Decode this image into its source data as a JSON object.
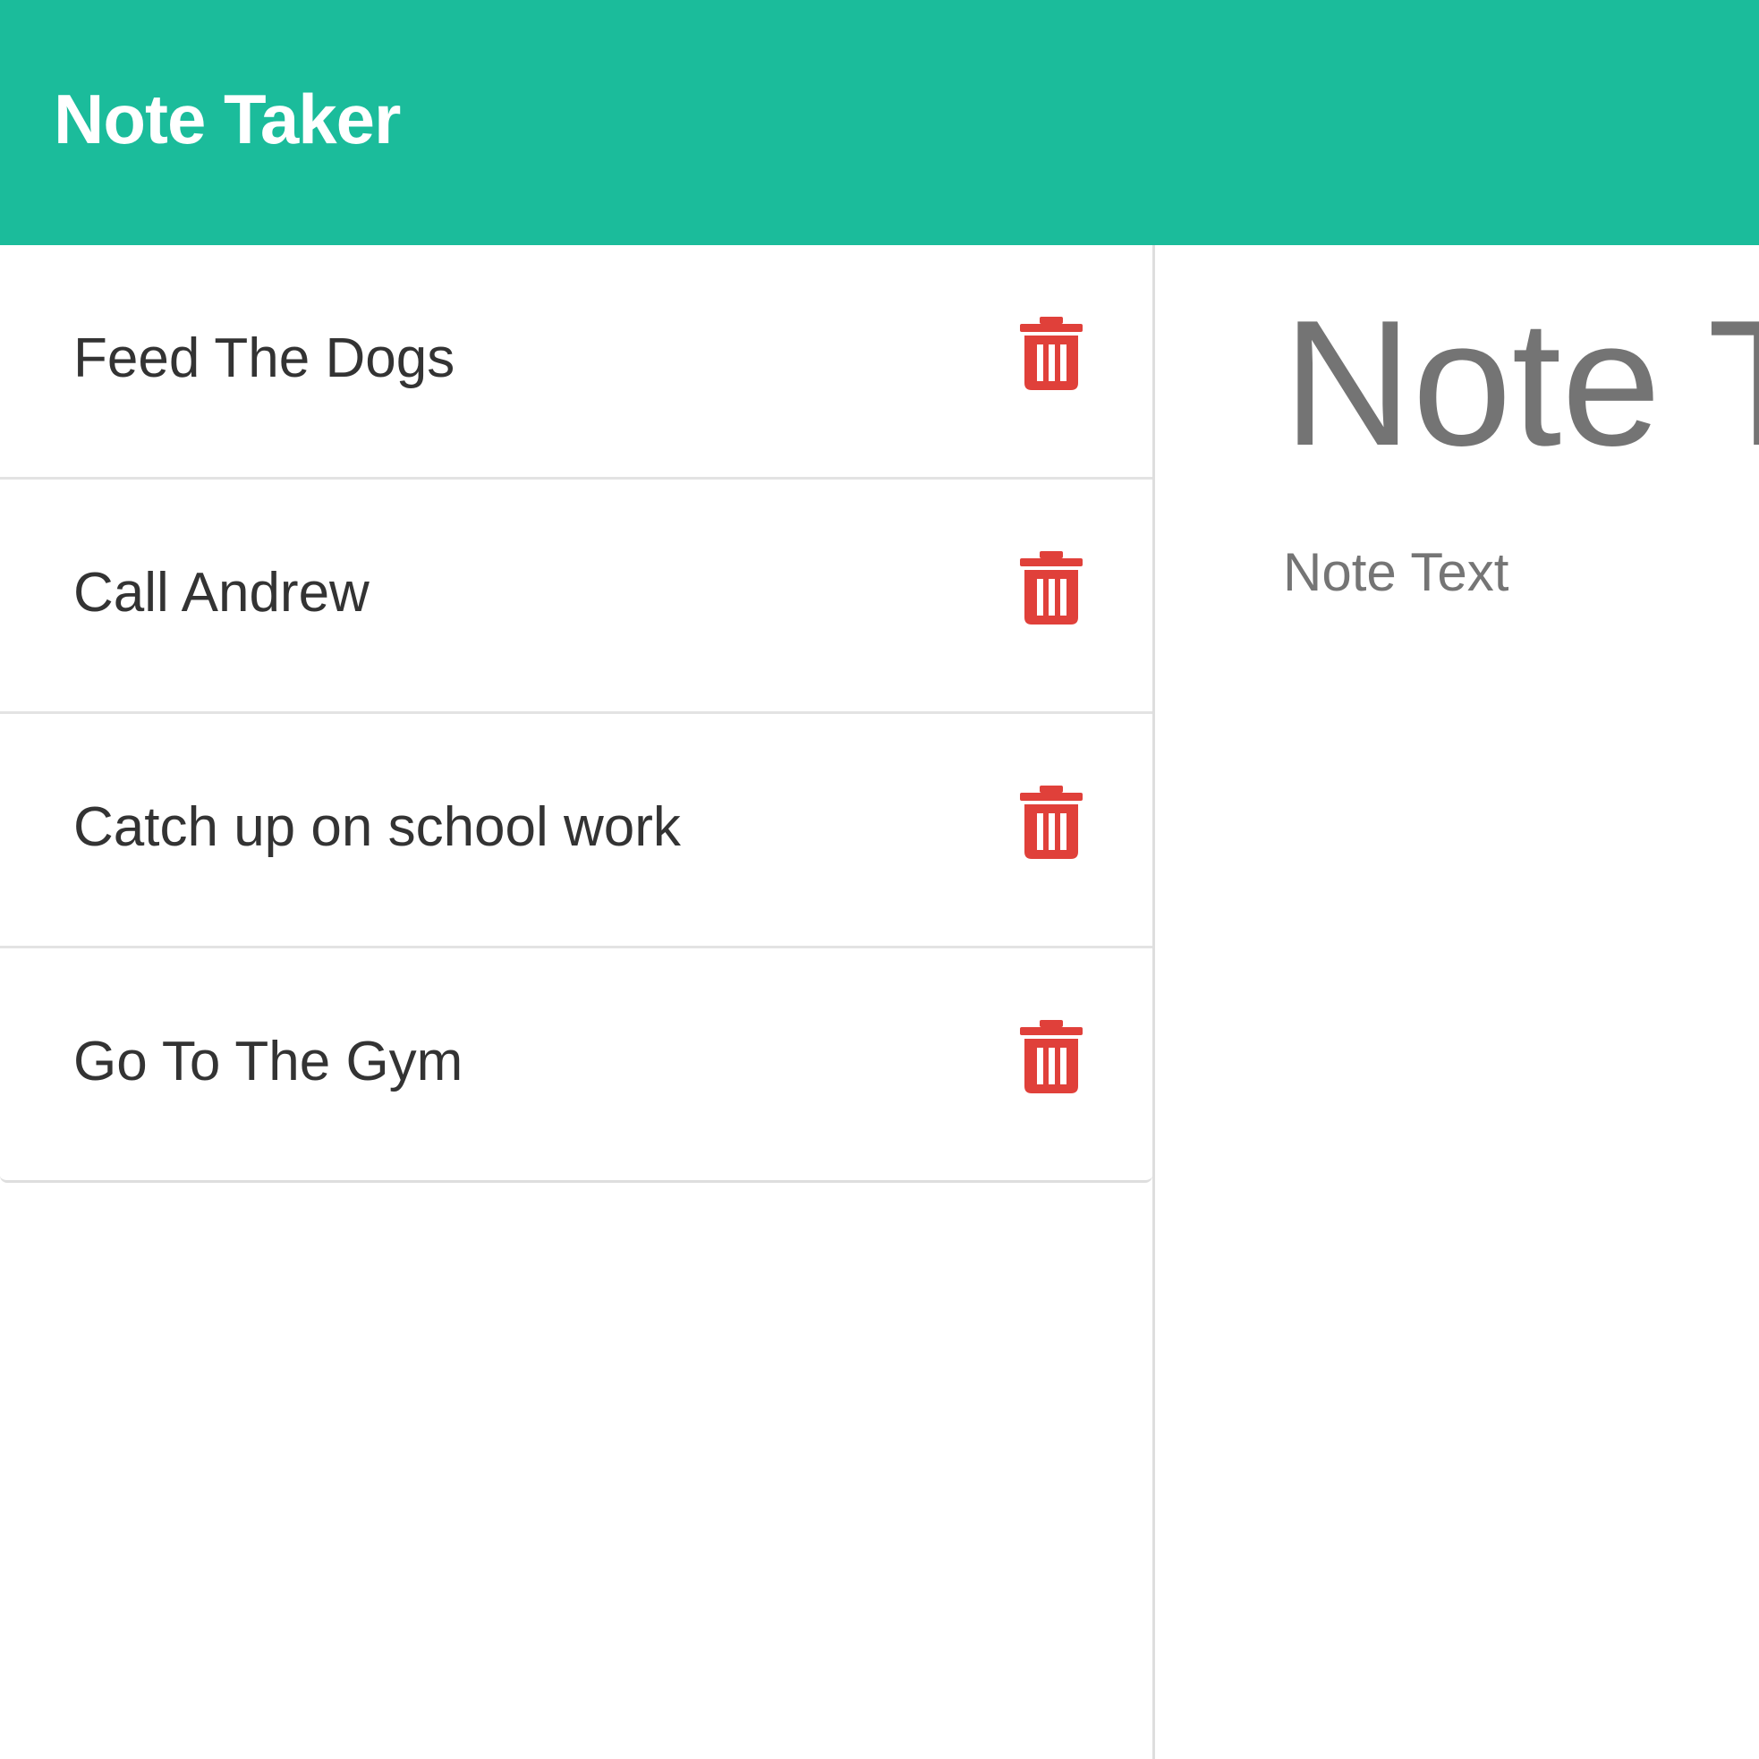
{
  "navbar": {
    "brand": "Note Taker",
    "color": "#1bbc9b"
  },
  "notes": [
    {
      "title": "Feed The Dogs",
      "delete_icon": "trash-icon"
    },
    {
      "title": "Call Andrew",
      "delete_icon": "trash-icon"
    },
    {
      "title": "Catch up on school work",
      "delete_icon": "trash-icon"
    },
    {
      "title": "Go To The Gym",
      "delete_icon": "trash-icon"
    }
  ],
  "editor": {
    "title_placeholder": "Note Title",
    "text_placeholder": "Note Text"
  },
  "colors": {
    "accent": "#1bbc9b",
    "delete": "#e0403a",
    "text": "#333333",
    "placeholder": "#757575"
  }
}
